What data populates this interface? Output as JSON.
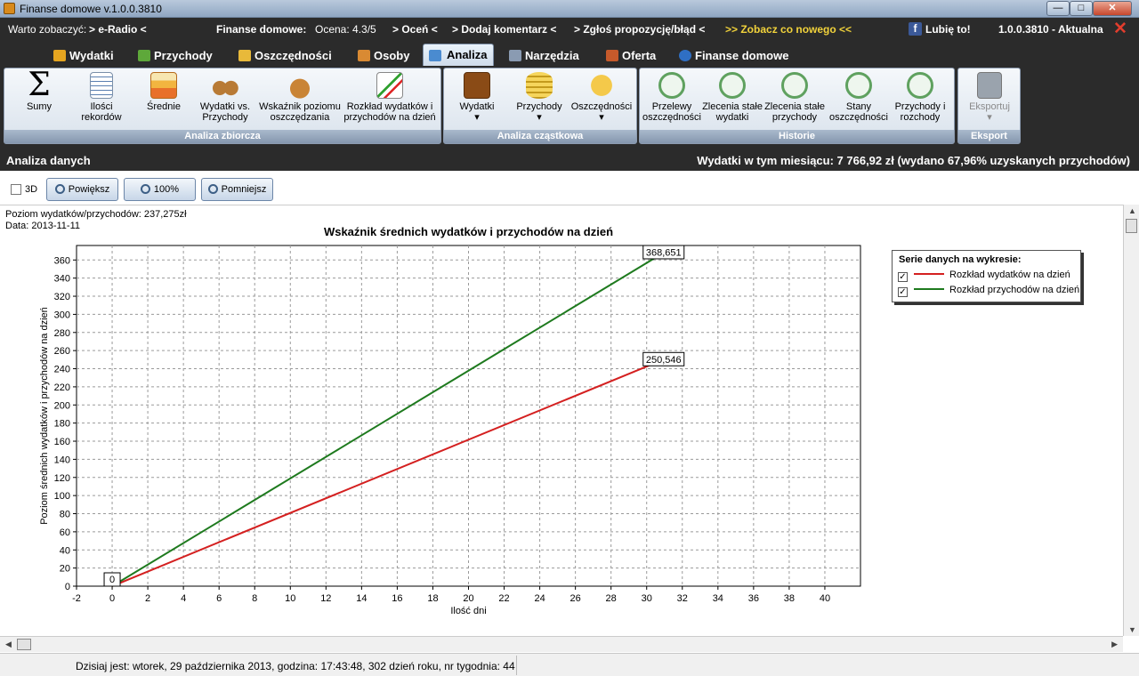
{
  "window": {
    "title": "Finanse domowe v.1.0.0.3810",
    "minimize": "—",
    "maximize": "□",
    "close": "✕"
  },
  "infobar": {
    "see_label": "Warto zobaczyć:",
    "eradio": "> e-Radio <",
    "fd_label": "Finanse domowe:",
    "rating": "Ocena: 4.3/5",
    "rate": "> Oceń <",
    "comment": "> Dodaj komentarz <",
    "report": "> Zgłoś propozycję/błąd <",
    "whats_new": ">> Zobacz co nowego <<",
    "like": "Lubię to!",
    "version": "1.0.0.3810 - Aktualna"
  },
  "tabs": [
    {
      "label": "Wydatki",
      "color": "#e5a520"
    },
    {
      "label": "Przychody",
      "color": "#5ea83a"
    },
    {
      "label": "Oszczędności",
      "color": "#e8b93a"
    },
    {
      "label": "Osoby",
      "color": "#d98a33"
    },
    {
      "label": "Analiza",
      "color": "#4a8bd0"
    },
    {
      "label": "Narzędzia",
      "color": "#8a9bb2"
    },
    {
      "label": "Oferta",
      "color": "#c65a2b"
    },
    {
      "label": "Finanse domowe",
      "color": "#2f6fc4"
    }
  ],
  "ribbon": {
    "groups": [
      {
        "title": "Analiza zbiorcza",
        "buttons": [
          {
            "label": "Sumy",
            "icon": "sigma-icon"
          },
          {
            "label": "Ilości rekordów",
            "icon": "list-icon"
          },
          {
            "label": "Średnie",
            "icon": "bar-chart-icon"
          },
          {
            "label": "Wydatki vs. Przychody",
            "icon": "scales-icon"
          },
          {
            "label": "Wskaźnik poziomu oszczędzania",
            "icon": "money-bag-icon"
          },
          {
            "label": "Rozkład wydatków i przychodów na dzień",
            "icon": "line-chart-icon"
          }
        ]
      },
      {
        "title": "Analiza cząstkowa",
        "buttons": [
          {
            "label": "Wydatki",
            "icon": "wallet-icon"
          },
          {
            "label": "Przychody",
            "icon": "coins-icon"
          },
          {
            "label": "Oszczędności",
            "icon": "piggy-bank-icon"
          }
        ]
      },
      {
        "title": "Historie",
        "buttons": [
          {
            "label": "Przelewy oszczędności",
            "icon": "history-clock-icon"
          },
          {
            "label": "Zlecenia stałe wydatki",
            "icon": "history-clock-icon"
          },
          {
            "label": "Zlecenia stałe przychody",
            "icon": "history-clock-icon"
          },
          {
            "label": "Stany oszczędności",
            "icon": "history-clock-icon"
          },
          {
            "label": "Przychody i rozchody",
            "icon": "history-clock-icon"
          }
        ]
      },
      {
        "title": "Eksport",
        "buttons": [
          {
            "label": "Eksportuj",
            "icon": "export-icon"
          }
        ]
      }
    ],
    "dropdown_arrow": "▾"
  },
  "section": {
    "title": "Analiza danych",
    "summary": "Wydatki w tym miesiącu: 7 766,92 zł (wydano 67,96% uzyskanych przychodów)"
  },
  "toolbar": {
    "label_3d": "3D",
    "zoom_in": "Powiększ",
    "zoom_100": "100%",
    "zoom_out": "Pomniejsz"
  },
  "chart_info": {
    "level": "Poziom wydatków/przychodów: 237,275zł",
    "date": "Data: 2013-11-11"
  },
  "chart_data": {
    "type": "line",
    "title": "Wskaźnik średnich wydatków i przychodów na dzień",
    "xlabel": "Ilość dni",
    "ylabel": "Poziom średnich wydatków i przychodów na dzień",
    "xlim": [
      -2,
      42
    ],
    "ylim": [
      0,
      376
    ],
    "xticks": [
      -2,
      0,
      2,
      4,
      6,
      8,
      10,
      12,
      14,
      16,
      18,
      20,
      22,
      24,
      26,
      28,
      30,
      32,
      34,
      36,
      38,
      40
    ],
    "yticks": [
      0,
      20,
      40,
      60,
      80,
      100,
      120,
      140,
      160,
      180,
      200,
      220,
      240,
      260,
      280,
      300,
      320,
      340,
      360
    ],
    "grid": true,
    "legend_title": "Serie danych na wykresie:",
    "legend_position": "right",
    "series": [
      {
        "name": "Rozkład wydatków na dzień",
        "color": "#d42020",
        "x": [
          0,
          31
        ],
        "y": [
          0,
          250.546
        ],
        "end_label": "250,546"
      },
      {
        "name": "Rozkład przychodów na dzień",
        "color": "#1e7a1e",
        "x": [
          0,
          31
        ],
        "y": [
          0,
          368.651
        ],
        "end_label": "368,651"
      }
    ],
    "start_label": "0"
  },
  "footer": {
    "today": "Dzisiaj jest: wtorek,  29 października 2013, godzina: 17:43:48, 302 dzień roku, nr tygodnia: 44"
  }
}
